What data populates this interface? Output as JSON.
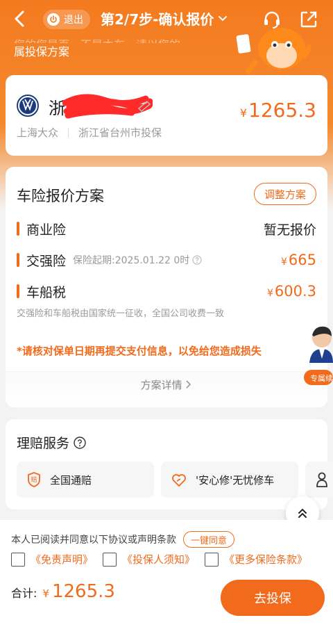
{
  "colors": {
    "accent": "#f26a1b",
    "header": "#f47a1f"
  },
  "header": {
    "exit_label": "退出",
    "step_title": "第2/7步-确认报价",
    "icons": [
      "back-icon",
      "headset-icon",
      "share-icon"
    ]
  },
  "hero": {
    "line1": "您的您是页，不是本车，请以您的",
    "line2": "属投保方案"
  },
  "car": {
    "plate": "浙3",
    "price_symbol": "¥",
    "price": "1265.3",
    "brand": "上海大众",
    "region": "浙江省台州市投保"
  },
  "plan": {
    "title": "车险报价方案",
    "adjust_label": "调整方案",
    "items": [
      {
        "name": "商业险",
        "hint": "",
        "value": "暂无报价",
        "symbol": ""
      },
      {
        "name": "交强险",
        "hint": "保险起期:2025.01.22 0时",
        "value": "665",
        "symbol": "¥"
      },
      {
        "name": "车船税",
        "hint": "",
        "value": "600.3",
        "symbol": "¥"
      }
    ],
    "note": "交强险和车船税由国家统一征收，全国公司收费一致",
    "warning": "*请核对保单日期再提交支付信息，以免给您造成损失",
    "detail_link": "方案详情"
  },
  "agent_badge": "专属续",
  "claim": {
    "title": "理赔服务",
    "items": [
      {
        "label": "全国通赔",
        "icon": "shield-icon"
      },
      {
        "label": "'安心修'无忧修车",
        "icon": "wrench-heart-icon"
      },
      {
        "label": "",
        "icon": "person-icon"
      }
    ]
  },
  "bottom": {
    "agreement_text": "本人已阅读并同意以下协议或声明条款",
    "agree_all_label": "一键同意",
    "terms": [
      "《免责声明》",
      "《投保人须知》",
      "《更多保险条款》"
    ],
    "total_label": "合计:",
    "total_symbol": "¥",
    "total_amount": "1265.3",
    "submit_label": "去投保"
  }
}
